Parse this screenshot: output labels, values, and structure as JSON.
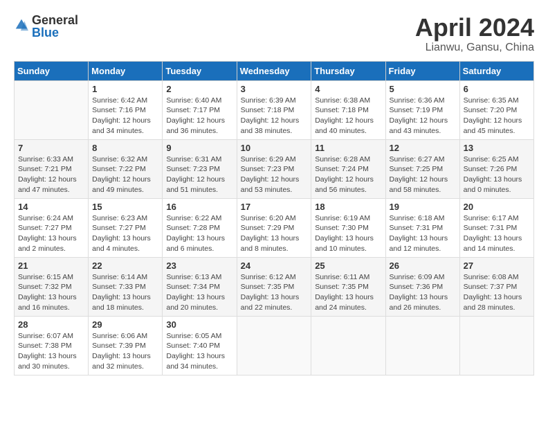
{
  "logo": {
    "general": "General",
    "blue": "Blue"
  },
  "header": {
    "month": "April 2024",
    "location": "Lianwu, Gansu, China"
  },
  "weekdays": [
    "Sunday",
    "Monday",
    "Tuesday",
    "Wednesday",
    "Thursday",
    "Friday",
    "Saturday"
  ],
  "weeks": [
    [
      {
        "day": "",
        "sunrise": "",
        "sunset": "",
        "daylight": ""
      },
      {
        "day": "1",
        "sunrise": "Sunrise: 6:42 AM",
        "sunset": "Sunset: 7:16 PM",
        "daylight": "Daylight: 12 hours and 34 minutes."
      },
      {
        "day": "2",
        "sunrise": "Sunrise: 6:40 AM",
        "sunset": "Sunset: 7:17 PM",
        "daylight": "Daylight: 12 hours and 36 minutes."
      },
      {
        "day": "3",
        "sunrise": "Sunrise: 6:39 AM",
        "sunset": "Sunset: 7:18 PM",
        "daylight": "Daylight: 12 hours and 38 minutes."
      },
      {
        "day": "4",
        "sunrise": "Sunrise: 6:38 AM",
        "sunset": "Sunset: 7:18 PM",
        "daylight": "Daylight: 12 hours and 40 minutes."
      },
      {
        "day": "5",
        "sunrise": "Sunrise: 6:36 AM",
        "sunset": "Sunset: 7:19 PM",
        "daylight": "Daylight: 12 hours and 43 minutes."
      },
      {
        "day": "6",
        "sunrise": "Sunrise: 6:35 AM",
        "sunset": "Sunset: 7:20 PM",
        "daylight": "Daylight: 12 hours and 45 minutes."
      }
    ],
    [
      {
        "day": "7",
        "sunrise": "Sunrise: 6:33 AM",
        "sunset": "Sunset: 7:21 PM",
        "daylight": "Daylight: 12 hours and 47 minutes."
      },
      {
        "day": "8",
        "sunrise": "Sunrise: 6:32 AM",
        "sunset": "Sunset: 7:22 PM",
        "daylight": "Daylight: 12 hours and 49 minutes."
      },
      {
        "day": "9",
        "sunrise": "Sunrise: 6:31 AM",
        "sunset": "Sunset: 7:23 PM",
        "daylight": "Daylight: 12 hours and 51 minutes."
      },
      {
        "day": "10",
        "sunrise": "Sunrise: 6:29 AM",
        "sunset": "Sunset: 7:23 PM",
        "daylight": "Daylight: 12 hours and 53 minutes."
      },
      {
        "day": "11",
        "sunrise": "Sunrise: 6:28 AM",
        "sunset": "Sunset: 7:24 PM",
        "daylight": "Daylight: 12 hours and 56 minutes."
      },
      {
        "day": "12",
        "sunrise": "Sunrise: 6:27 AM",
        "sunset": "Sunset: 7:25 PM",
        "daylight": "Daylight: 12 hours and 58 minutes."
      },
      {
        "day": "13",
        "sunrise": "Sunrise: 6:25 AM",
        "sunset": "Sunset: 7:26 PM",
        "daylight": "Daylight: 13 hours and 0 minutes."
      }
    ],
    [
      {
        "day": "14",
        "sunrise": "Sunrise: 6:24 AM",
        "sunset": "Sunset: 7:27 PM",
        "daylight": "Daylight: 13 hours and 2 minutes."
      },
      {
        "day": "15",
        "sunrise": "Sunrise: 6:23 AM",
        "sunset": "Sunset: 7:27 PM",
        "daylight": "Daylight: 13 hours and 4 minutes."
      },
      {
        "day": "16",
        "sunrise": "Sunrise: 6:22 AM",
        "sunset": "Sunset: 7:28 PM",
        "daylight": "Daylight: 13 hours and 6 minutes."
      },
      {
        "day": "17",
        "sunrise": "Sunrise: 6:20 AM",
        "sunset": "Sunset: 7:29 PM",
        "daylight": "Daylight: 13 hours and 8 minutes."
      },
      {
        "day": "18",
        "sunrise": "Sunrise: 6:19 AM",
        "sunset": "Sunset: 7:30 PM",
        "daylight": "Daylight: 13 hours and 10 minutes."
      },
      {
        "day": "19",
        "sunrise": "Sunrise: 6:18 AM",
        "sunset": "Sunset: 7:31 PM",
        "daylight": "Daylight: 13 hours and 12 minutes."
      },
      {
        "day": "20",
        "sunrise": "Sunrise: 6:17 AM",
        "sunset": "Sunset: 7:31 PM",
        "daylight": "Daylight: 13 hours and 14 minutes."
      }
    ],
    [
      {
        "day": "21",
        "sunrise": "Sunrise: 6:15 AM",
        "sunset": "Sunset: 7:32 PM",
        "daylight": "Daylight: 13 hours and 16 minutes."
      },
      {
        "day": "22",
        "sunrise": "Sunrise: 6:14 AM",
        "sunset": "Sunset: 7:33 PM",
        "daylight": "Daylight: 13 hours and 18 minutes."
      },
      {
        "day": "23",
        "sunrise": "Sunrise: 6:13 AM",
        "sunset": "Sunset: 7:34 PM",
        "daylight": "Daylight: 13 hours and 20 minutes."
      },
      {
        "day": "24",
        "sunrise": "Sunrise: 6:12 AM",
        "sunset": "Sunset: 7:35 PM",
        "daylight": "Daylight: 13 hours and 22 minutes."
      },
      {
        "day": "25",
        "sunrise": "Sunrise: 6:11 AM",
        "sunset": "Sunset: 7:35 PM",
        "daylight": "Daylight: 13 hours and 24 minutes."
      },
      {
        "day": "26",
        "sunrise": "Sunrise: 6:09 AM",
        "sunset": "Sunset: 7:36 PM",
        "daylight": "Daylight: 13 hours and 26 minutes."
      },
      {
        "day": "27",
        "sunrise": "Sunrise: 6:08 AM",
        "sunset": "Sunset: 7:37 PM",
        "daylight": "Daylight: 13 hours and 28 minutes."
      }
    ],
    [
      {
        "day": "28",
        "sunrise": "Sunrise: 6:07 AM",
        "sunset": "Sunset: 7:38 PM",
        "daylight": "Daylight: 13 hours and 30 minutes."
      },
      {
        "day": "29",
        "sunrise": "Sunrise: 6:06 AM",
        "sunset": "Sunset: 7:39 PM",
        "daylight": "Daylight: 13 hours and 32 minutes."
      },
      {
        "day": "30",
        "sunrise": "Sunrise: 6:05 AM",
        "sunset": "Sunset: 7:40 PM",
        "daylight": "Daylight: 13 hours and 34 minutes."
      },
      {
        "day": "",
        "sunrise": "",
        "sunset": "",
        "daylight": ""
      },
      {
        "day": "",
        "sunrise": "",
        "sunset": "",
        "daylight": ""
      },
      {
        "day": "",
        "sunrise": "",
        "sunset": "",
        "daylight": ""
      },
      {
        "day": "",
        "sunrise": "",
        "sunset": "",
        "daylight": ""
      }
    ]
  ]
}
